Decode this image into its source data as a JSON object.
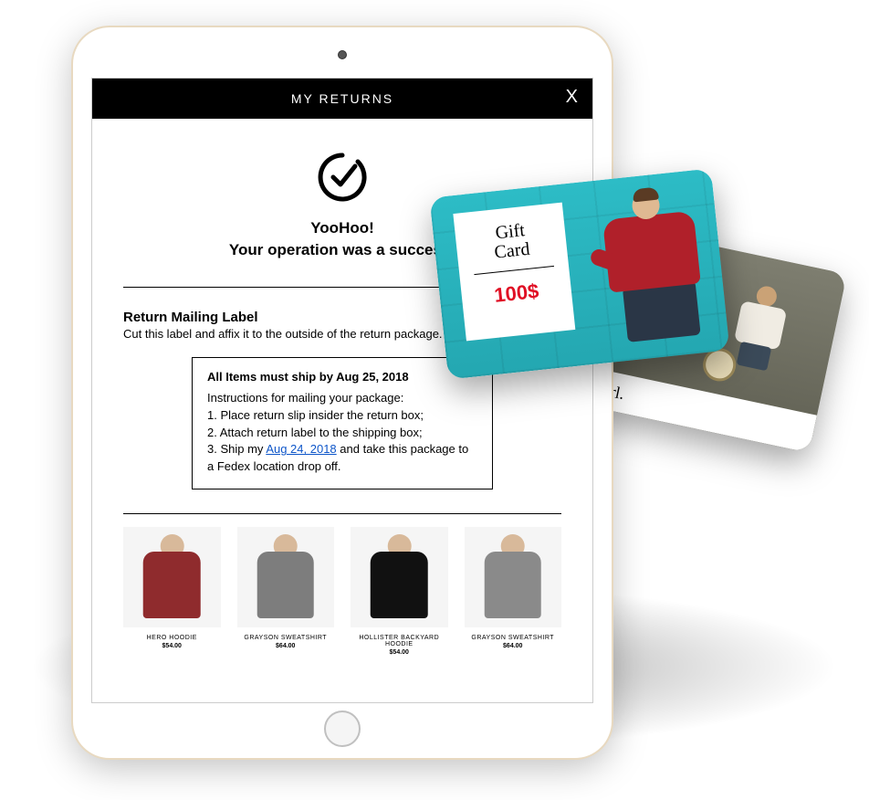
{
  "header": {
    "title": "MY RETURNS",
    "close": "X"
  },
  "success": {
    "line1": "YooHoo!",
    "line2": "Your operation was a success!"
  },
  "mailing": {
    "title": "Return Mailing Label",
    "sub": "Cut this label and affix it to the outside of the return package."
  },
  "shipbox": {
    "headline": "All Items must ship by Aug 25, 2018",
    "intro": "Instructions for mailing your package:",
    "step1": "1. Place return slip insider the return box;",
    "step2": "2. Attach return label to the shipping box;",
    "step3a": "3. Ship my ",
    "step3_link": "Aug 24, 2018",
    "step3b": " and take this package to a Fedex location drop off."
  },
  "products": [
    {
      "name": "HERO HOODIE",
      "price": "$54.00"
    },
    {
      "name": "GRAYSON SWEATSHIRT",
      "price": "$64.00"
    },
    {
      "name": "HOLLISTER BACKYARD HOODIE",
      "price": "$54.00"
    },
    {
      "name": "GRAYSON SWEATSHIRT",
      "price": "$64.00"
    }
  ],
  "giftcard": {
    "label_line1": "Gift",
    "label_line2": "Card",
    "amount": "100$"
  },
  "brand": {
    "name": "pearl."
  }
}
